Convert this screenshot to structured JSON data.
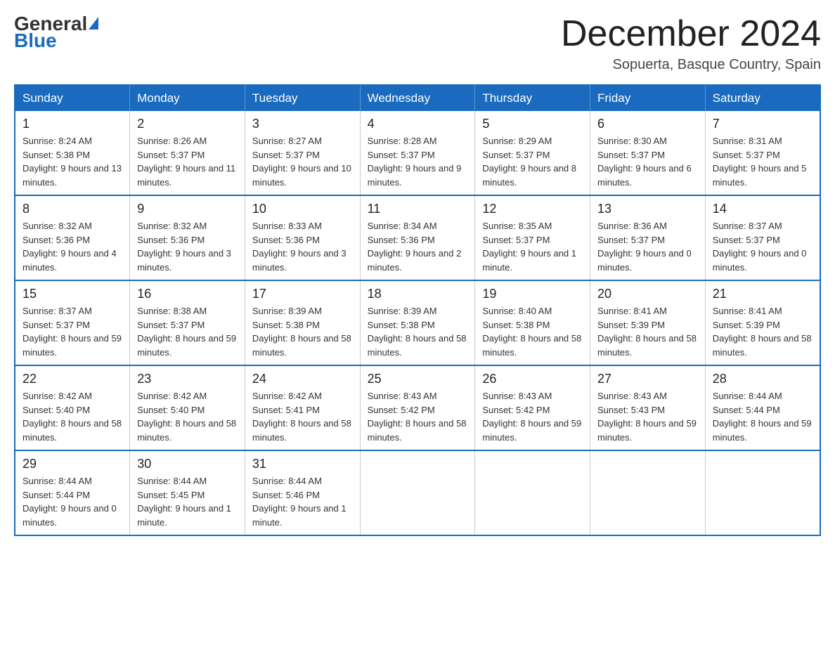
{
  "logo": {
    "general": "General",
    "blue": "Blue"
  },
  "header": {
    "title": "December 2024",
    "location": "Sopuerta, Basque Country, Spain"
  },
  "columns": [
    "Sunday",
    "Monday",
    "Tuesday",
    "Wednesday",
    "Thursday",
    "Friday",
    "Saturday"
  ],
  "weeks": [
    [
      {
        "day": "1",
        "sunrise": "Sunrise: 8:24 AM",
        "sunset": "Sunset: 5:38 PM",
        "daylight": "Daylight: 9 hours and 13 minutes."
      },
      {
        "day": "2",
        "sunrise": "Sunrise: 8:26 AM",
        "sunset": "Sunset: 5:37 PM",
        "daylight": "Daylight: 9 hours and 11 minutes."
      },
      {
        "day": "3",
        "sunrise": "Sunrise: 8:27 AM",
        "sunset": "Sunset: 5:37 PM",
        "daylight": "Daylight: 9 hours and 10 minutes."
      },
      {
        "day": "4",
        "sunrise": "Sunrise: 8:28 AM",
        "sunset": "Sunset: 5:37 PM",
        "daylight": "Daylight: 9 hours and 9 minutes."
      },
      {
        "day": "5",
        "sunrise": "Sunrise: 8:29 AM",
        "sunset": "Sunset: 5:37 PM",
        "daylight": "Daylight: 9 hours and 8 minutes."
      },
      {
        "day": "6",
        "sunrise": "Sunrise: 8:30 AM",
        "sunset": "Sunset: 5:37 PM",
        "daylight": "Daylight: 9 hours and 6 minutes."
      },
      {
        "day": "7",
        "sunrise": "Sunrise: 8:31 AM",
        "sunset": "Sunset: 5:37 PM",
        "daylight": "Daylight: 9 hours and 5 minutes."
      }
    ],
    [
      {
        "day": "8",
        "sunrise": "Sunrise: 8:32 AM",
        "sunset": "Sunset: 5:36 PM",
        "daylight": "Daylight: 9 hours and 4 minutes."
      },
      {
        "day": "9",
        "sunrise": "Sunrise: 8:32 AM",
        "sunset": "Sunset: 5:36 PM",
        "daylight": "Daylight: 9 hours and 3 minutes."
      },
      {
        "day": "10",
        "sunrise": "Sunrise: 8:33 AM",
        "sunset": "Sunset: 5:36 PM",
        "daylight": "Daylight: 9 hours and 3 minutes."
      },
      {
        "day": "11",
        "sunrise": "Sunrise: 8:34 AM",
        "sunset": "Sunset: 5:36 PM",
        "daylight": "Daylight: 9 hours and 2 minutes."
      },
      {
        "day": "12",
        "sunrise": "Sunrise: 8:35 AM",
        "sunset": "Sunset: 5:37 PM",
        "daylight": "Daylight: 9 hours and 1 minute."
      },
      {
        "day": "13",
        "sunrise": "Sunrise: 8:36 AM",
        "sunset": "Sunset: 5:37 PM",
        "daylight": "Daylight: 9 hours and 0 minutes."
      },
      {
        "day": "14",
        "sunrise": "Sunrise: 8:37 AM",
        "sunset": "Sunset: 5:37 PM",
        "daylight": "Daylight: 9 hours and 0 minutes."
      }
    ],
    [
      {
        "day": "15",
        "sunrise": "Sunrise: 8:37 AM",
        "sunset": "Sunset: 5:37 PM",
        "daylight": "Daylight: 8 hours and 59 minutes."
      },
      {
        "day": "16",
        "sunrise": "Sunrise: 8:38 AM",
        "sunset": "Sunset: 5:37 PM",
        "daylight": "Daylight: 8 hours and 59 minutes."
      },
      {
        "day": "17",
        "sunrise": "Sunrise: 8:39 AM",
        "sunset": "Sunset: 5:38 PM",
        "daylight": "Daylight: 8 hours and 58 minutes."
      },
      {
        "day": "18",
        "sunrise": "Sunrise: 8:39 AM",
        "sunset": "Sunset: 5:38 PM",
        "daylight": "Daylight: 8 hours and 58 minutes."
      },
      {
        "day": "19",
        "sunrise": "Sunrise: 8:40 AM",
        "sunset": "Sunset: 5:38 PM",
        "daylight": "Daylight: 8 hours and 58 minutes."
      },
      {
        "day": "20",
        "sunrise": "Sunrise: 8:41 AM",
        "sunset": "Sunset: 5:39 PM",
        "daylight": "Daylight: 8 hours and 58 minutes."
      },
      {
        "day": "21",
        "sunrise": "Sunrise: 8:41 AM",
        "sunset": "Sunset: 5:39 PM",
        "daylight": "Daylight: 8 hours and 58 minutes."
      }
    ],
    [
      {
        "day": "22",
        "sunrise": "Sunrise: 8:42 AM",
        "sunset": "Sunset: 5:40 PM",
        "daylight": "Daylight: 8 hours and 58 minutes."
      },
      {
        "day": "23",
        "sunrise": "Sunrise: 8:42 AM",
        "sunset": "Sunset: 5:40 PM",
        "daylight": "Daylight: 8 hours and 58 minutes."
      },
      {
        "day": "24",
        "sunrise": "Sunrise: 8:42 AM",
        "sunset": "Sunset: 5:41 PM",
        "daylight": "Daylight: 8 hours and 58 minutes."
      },
      {
        "day": "25",
        "sunrise": "Sunrise: 8:43 AM",
        "sunset": "Sunset: 5:42 PM",
        "daylight": "Daylight: 8 hours and 58 minutes."
      },
      {
        "day": "26",
        "sunrise": "Sunrise: 8:43 AM",
        "sunset": "Sunset: 5:42 PM",
        "daylight": "Daylight: 8 hours and 59 minutes."
      },
      {
        "day": "27",
        "sunrise": "Sunrise: 8:43 AM",
        "sunset": "Sunset: 5:43 PM",
        "daylight": "Daylight: 8 hours and 59 minutes."
      },
      {
        "day": "28",
        "sunrise": "Sunrise: 8:44 AM",
        "sunset": "Sunset: 5:44 PM",
        "daylight": "Daylight: 8 hours and 59 minutes."
      }
    ],
    [
      {
        "day": "29",
        "sunrise": "Sunrise: 8:44 AM",
        "sunset": "Sunset: 5:44 PM",
        "daylight": "Daylight: 9 hours and 0 minutes."
      },
      {
        "day": "30",
        "sunrise": "Sunrise: 8:44 AM",
        "sunset": "Sunset: 5:45 PM",
        "daylight": "Daylight: 9 hours and 1 minute."
      },
      {
        "day": "31",
        "sunrise": "Sunrise: 8:44 AM",
        "sunset": "Sunset: 5:46 PM",
        "daylight": "Daylight: 9 hours and 1 minute."
      },
      {
        "day": "",
        "sunrise": "",
        "sunset": "",
        "daylight": ""
      },
      {
        "day": "",
        "sunrise": "",
        "sunset": "",
        "daylight": ""
      },
      {
        "day": "",
        "sunrise": "",
        "sunset": "",
        "daylight": ""
      },
      {
        "day": "",
        "sunrise": "",
        "sunset": "",
        "daylight": ""
      }
    ]
  ]
}
